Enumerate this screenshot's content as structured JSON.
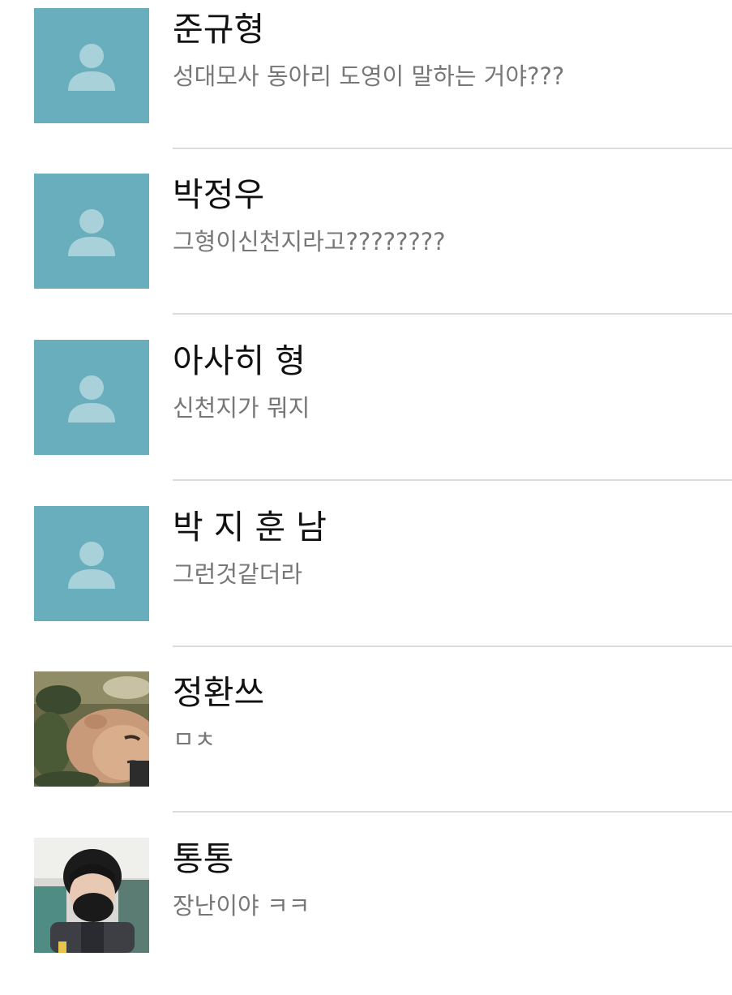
{
  "chats": [
    {
      "name": "준규형",
      "message": "성대모사 동아리 도영이 말하는 거야???",
      "avatar": "default-person-icon"
    },
    {
      "name": "박정우",
      "message": "그형이신천지라고????????",
      "avatar": "default-person-icon"
    },
    {
      "name": "아사히 형",
      "message": "신천지가 뭐지",
      "avatar": "default-person-icon"
    },
    {
      "name": "박 지 훈 남",
      "message": "그런것같더라",
      "avatar": "default-person-icon"
    },
    {
      "name": "정환쓰",
      "message": "ㅁㅊ",
      "avatar": "profile-photo"
    },
    {
      "name": "통통",
      "message": "장난이야 ㅋㅋ",
      "avatar": "profile-photo"
    }
  ],
  "colors": {
    "default_avatar_bg": "#68aebd",
    "default_avatar_glyph": "#a9d1da",
    "name_text": "#111111",
    "message_text": "#777777",
    "divider": "#dcdcdc"
  }
}
